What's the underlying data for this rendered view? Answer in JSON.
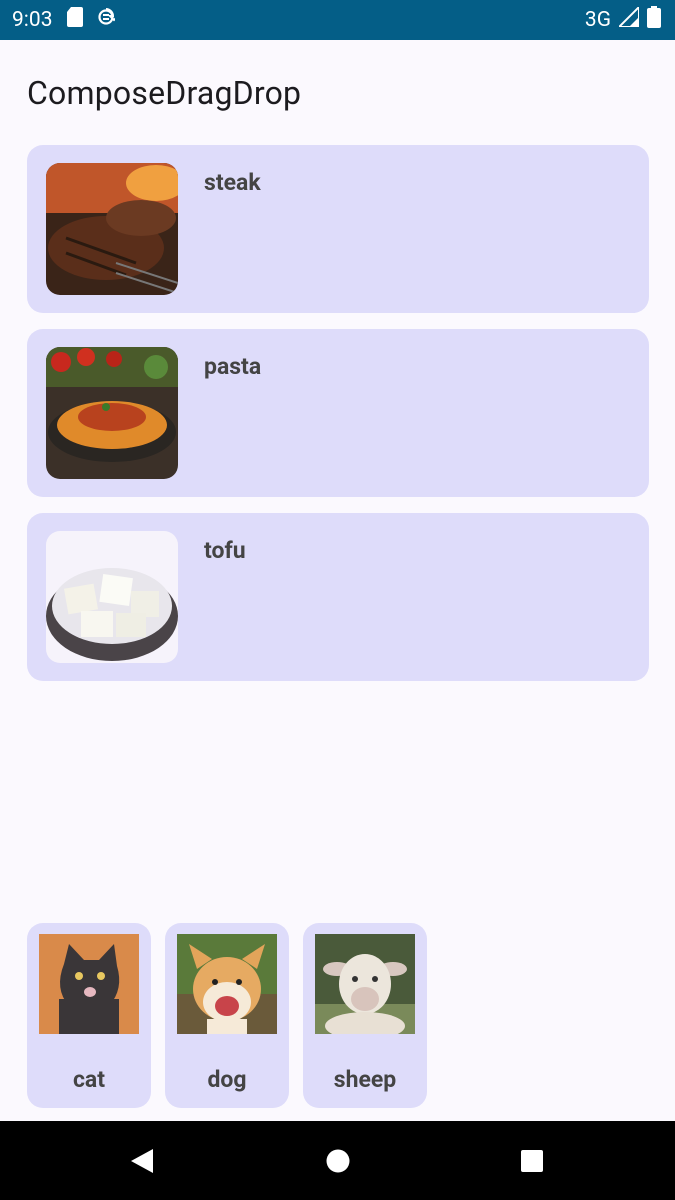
{
  "status_bar": {
    "time": "9:03",
    "network": "3G",
    "icons": [
      "sd-card-icon",
      "sync-icon",
      "signal-icon",
      "battery-icon"
    ]
  },
  "app": {
    "title": "ComposeDragDrop"
  },
  "food_items": [
    {
      "label": "steak",
      "image": "steak-image"
    },
    {
      "label": "pasta",
      "image": "pasta-image"
    },
    {
      "label": "tofu",
      "image": "tofu-image"
    }
  ],
  "animals": [
    {
      "label": "cat",
      "image": "cat-image"
    },
    {
      "label": "dog",
      "image": "dog-image"
    },
    {
      "label": "sheep",
      "image": "sheep-image"
    }
  ],
  "navigation": {
    "icons": [
      "back-icon",
      "home-icon",
      "recents-icon"
    ]
  },
  "colors": {
    "status_bar": "#045e87",
    "background": "#fbf9fe",
    "card": "#dedcfa",
    "label": "#444444"
  }
}
